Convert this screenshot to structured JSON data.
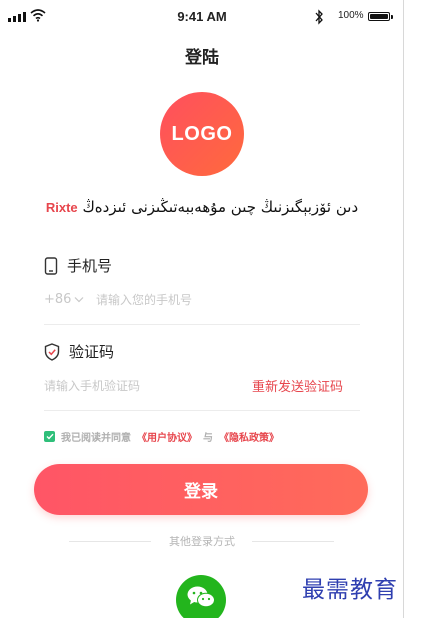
{
  "status_bar": {
    "time": "9:41 AM",
    "battery_percent": "100%",
    "icons": [
      "signal-icon",
      "wifi-icon",
      "bluetooth-icon",
      "battery-icon"
    ]
  },
  "nav": {
    "title": "登陆"
  },
  "logo": {
    "text": "LOGO",
    "colors": [
      "#ff4f5e",
      "#ff6a3d"
    ]
  },
  "welcome": {
    "brand": "Rixte",
    "text": "دىن ئۆزبېگىزنىڭ چىن مۇھەببەتىڭىزنى ئىزدەڭ"
  },
  "phone_field": {
    "label": "手机号",
    "prefix": "+86",
    "placeholder": "请输入您的手机号",
    "value": ""
  },
  "code_field": {
    "label": "验证码",
    "placeholder": "请输入手机验证码",
    "value": "",
    "resend_label": "重新发送验证码"
  },
  "agreement": {
    "checked": true,
    "prefix": "我已阅读并同意",
    "user_agreement": "《用户协议》",
    "joiner": "与",
    "privacy_policy": "《隐私政策》"
  },
  "login_button": {
    "label": "登录"
  },
  "other_login": {
    "label": "其他登录方式",
    "methods": [
      "wechat-icon"
    ]
  },
  "watermark": {
    "text": "最需教育"
  },
  "colors": {
    "accent": "#e7464d",
    "button_gradient": [
      "#ff5566",
      "#ff6b5a"
    ],
    "checkbox": "#2fbf7a",
    "wechat": "#23b51d",
    "watermark": "#2f3fb0"
  }
}
